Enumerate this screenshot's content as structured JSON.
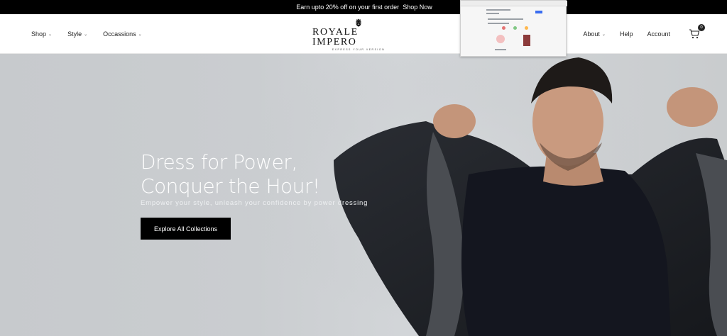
{
  "announcement": {
    "text": "Earn upto 20% off on your first order",
    "link": "Shop Now"
  },
  "nav_left": [
    {
      "label": "Shop",
      "dropdown": true
    },
    {
      "label": "Style",
      "dropdown": true
    },
    {
      "label": "Occassions",
      "dropdown": true
    }
  ],
  "brand": {
    "name": "ROYALE IMPERO",
    "tagline": "EXPRESS YOUR VERSION"
  },
  "nav_right": [
    {
      "label": "About",
      "dropdown": true
    },
    {
      "label": "Help",
      "dropdown": false
    },
    {
      "label": "Account",
      "dropdown": false
    }
  ],
  "cart": {
    "count": "0",
    "icon": "cart-icon"
  },
  "hero": {
    "title_line1": "Dress for Power,",
    "title_line2": "Conquer the Hour!",
    "subtitle": "Empower your style, unleash your confidence by power dressing",
    "cta": "Explore All Collections"
  },
  "colors": {
    "topbar": "#000000",
    "hero_bg": "#cbced1",
    "button": "#000000",
    "text_light": "#ffffff"
  }
}
